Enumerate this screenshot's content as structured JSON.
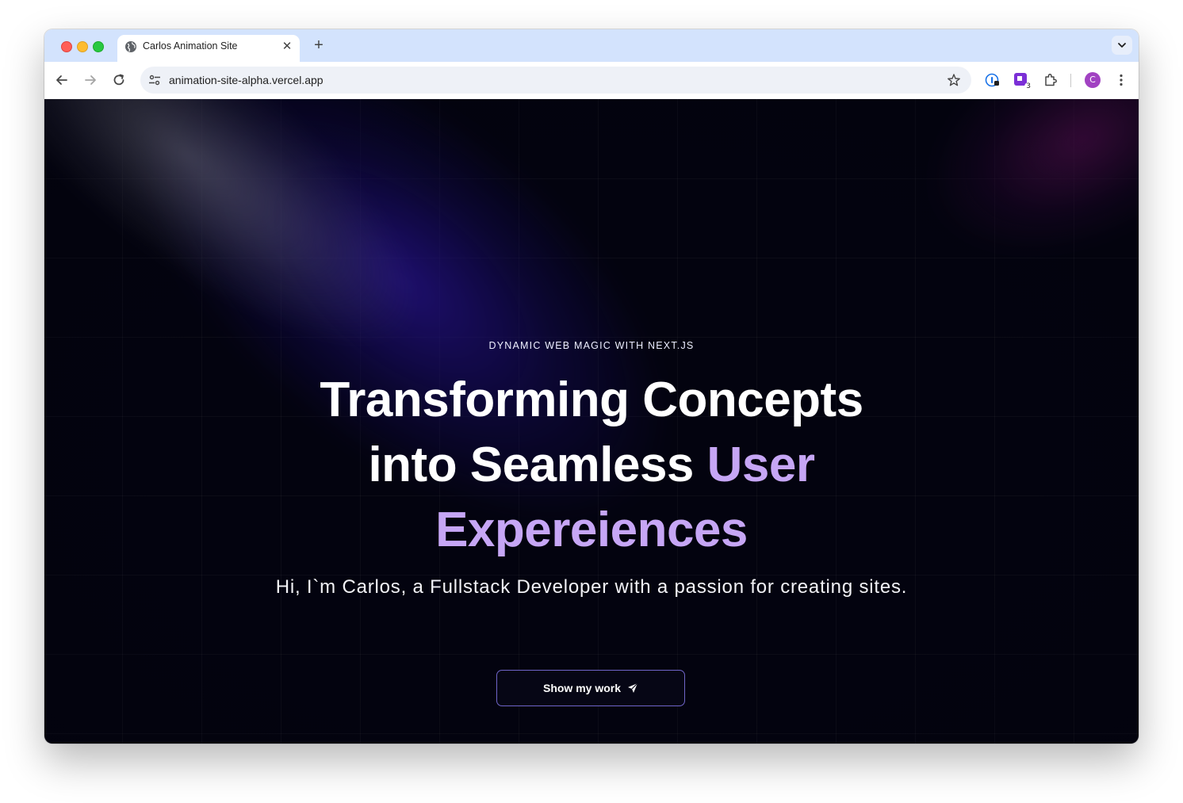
{
  "browser": {
    "tab": {
      "title": "Carlos Animation Site",
      "close_glyph": "✕"
    },
    "new_tab_glyph": "+",
    "url": "animation-site-alpha.vercel.app",
    "profile_initial": "C",
    "extension_badge": "3"
  },
  "hero": {
    "eyebrow": "DYNAMIC WEB MAGIC WITH NEXT.JS",
    "headline_plain": "Transforming Concepts into Seamless",
    "headline_accent": "User Expereiences",
    "subtitle": "Hi, I`m Carlos, a Fullstack Developer with a passion for creating sites.",
    "cta_label": "Show my work"
  },
  "colors": {
    "page_bg": "#03030f",
    "accent_text": "#c6a6f5",
    "cta_border": "#6f65c8",
    "tabstrip": "#d3e3fd"
  },
  "icons": {
    "tab": "globe-icon",
    "nav": [
      "back-arrow-icon",
      "forward-arrow-icon",
      "reload-icon"
    ],
    "omnibox": [
      "site-settings-icon",
      "bookmark-star-icon"
    ],
    "extensions": [
      "password-manager-icon",
      "purple-extension-icon",
      "puzzle-extensions-icon"
    ],
    "cta": "send-arrow-icon"
  }
}
